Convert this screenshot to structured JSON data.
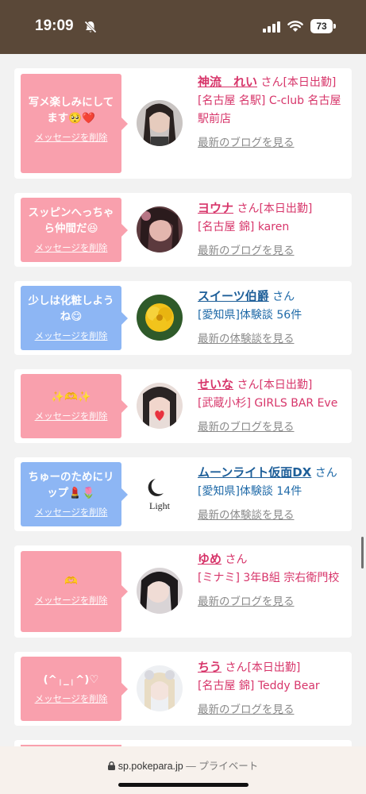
{
  "status": {
    "time": "19:09",
    "battery": "73"
  },
  "entries": [
    {
      "message": "写メ楽しみにしてます🥺❤️",
      "delete_label": "メッセージを削除",
      "name": "神流　れい",
      "suffix": "さん[本日出勤]",
      "detail": "[名古屋 名駅] C-club 名古屋駅前店",
      "link": "最新のブログを見る",
      "theme": "pink"
    },
    {
      "message": "スッピンへっちゃら仲間だ😆",
      "delete_label": "メッセージを削除",
      "name": "ヨウナ",
      "suffix": "さん[本日出勤]",
      "detail": "[名古屋 錦] karen",
      "link": "最新のブログを見る",
      "theme": "pink"
    },
    {
      "message": "少しは化粧しようね😋",
      "delete_label": "メッセージを削除",
      "name": "スイーツ伯爵",
      "suffix": "さん",
      "detail": "[愛知県]体験談 56件",
      "link": "最新の体験談を見る",
      "theme": "blue"
    },
    {
      "message": "✨🫶✨",
      "delete_label": "メッセージを削除",
      "name": "せいな",
      "suffix": "さん[本日出勤]",
      "detail": "[武蔵小杉] GIRLS BAR Eve",
      "link": "最新のブログを見る",
      "theme": "pink"
    },
    {
      "message": "ちゅーのためにリップ💄🌷",
      "delete_label": "メッセージを削除",
      "name": "ムーンライト仮面DX",
      "suffix": "さん",
      "detail": "[愛知県]体験談 14件",
      "link": "最新の体験談を見る",
      "theme": "blue",
      "avatar_text": "Light"
    },
    {
      "message": "🫶",
      "delete_label": "メッセージを削除",
      "name": "ゆめ",
      "suffix": "さん",
      "detail": "[ミナミ] 3年B組 宗右衛門校",
      "link": "最新のブログを見る",
      "theme": "pink"
    },
    {
      "message": "(^╷_╷^)♡",
      "delete_label": "メッセージを削除",
      "name": "ちう",
      "suffix": "さん[本日出勤]",
      "detail": "[名古屋 錦] Teddy Bear",
      "link": "最新のブログを見る",
      "theme": "pink"
    }
  ],
  "browser": {
    "url": "sp.pokepara.jp",
    "separator": " — ",
    "privacy": "プライベート"
  }
}
